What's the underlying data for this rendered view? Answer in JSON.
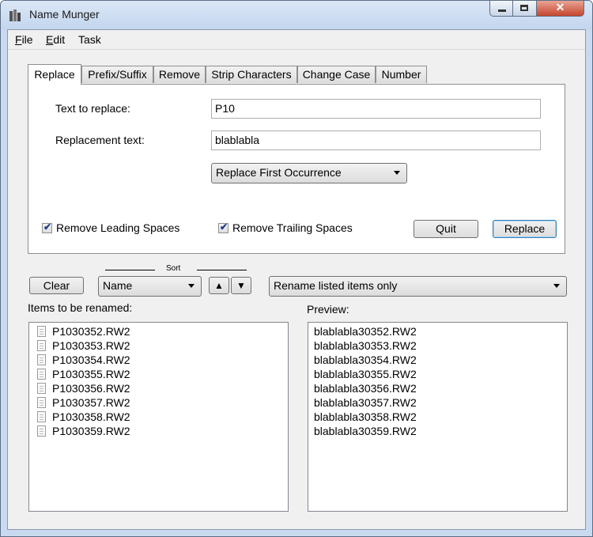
{
  "window": {
    "title": "Name Munger"
  },
  "titlebar_buttons": {
    "minimize": "minimize",
    "maximize": "maximize",
    "close": "✕"
  },
  "menu": [
    {
      "label": "File",
      "underline": "F",
      "rest": "ile"
    },
    {
      "label": "Edit",
      "underline": "E",
      "rest": "dit"
    },
    {
      "label": "Task",
      "underline": "",
      "rest": "Task"
    }
  ],
  "tabs": [
    "Replace",
    "Prefix/Suffix",
    "Remove",
    "Strip Characters",
    "Change Case",
    "Number"
  ],
  "replace_panel": {
    "text_to_replace_label": "Text to replace:",
    "text_to_replace_value": "P10",
    "replacement_label": "Replacement text:",
    "replacement_value": "blablabla",
    "mode_value": "Replace First Occurrence",
    "remove_leading_label": "Remove Leading Spaces",
    "remove_leading_checked": true,
    "remove_trailing_label": "Remove Trailing Spaces",
    "remove_trailing_checked": true,
    "quit_label": "Quit",
    "replace_label": "Replace"
  },
  "controls": {
    "clear_label": "Clear",
    "sort_label": "Sort",
    "sort_value": "Name",
    "sort_up": "▲",
    "sort_down": "▼",
    "rename_scope_value": "Rename listed items only"
  },
  "items_title": "Items to be renamed:",
  "preview_title": "Preview:",
  "items": [
    "P1030352.RW2",
    "P1030353.RW2",
    "P1030354.RW2",
    "P1030355.RW2",
    "P1030356.RW2",
    "P1030357.RW2",
    "P1030358.RW2",
    "P1030359.RW2"
  ],
  "preview": [
    "blablabla30352.RW2",
    "blablabla30353.RW2",
    "blablabla30354.RW2",
    "blablabla30355.RW2",
    "blablabla30356.RW2",
    "blablabla30357.RW2",
    "blablabla30358.RW2",
    "blablabla30359.RW2"
  ],
  "colors": {
    "title_bar": "#c9daf0",
    "close_button": "#c5452d",
    "default_button_border": "#3c7fb1"
  }
}
